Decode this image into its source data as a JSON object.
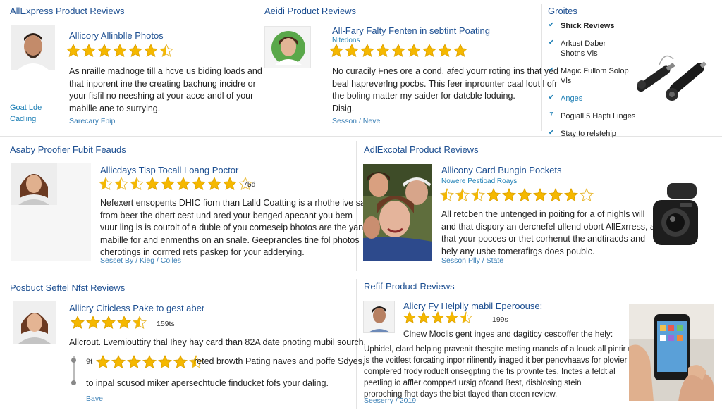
{
  "sections": {
    "s1": {
      "title": "AllExpress Product Reviews"
    },
    "s2": {
      "title": "Aeidi Product Reviews"
    },
    "s3": {
      "title": "Asaby Proofier Fubit Feauds"
    },
    "s4": {
      "title": "AdlExcotal Product Reviews"
    },
    "s5": {
      "title": "Posbuct Seftel Nfst Reviews"
    },
    "s6": {
      "title": "Refif-Product Reviews"
    }
  },
  "reviews": {
    "r1": {
      "name": "Allicory Allinblle Photos",
      "rating": 6.5,
      "lines": [
        "As nraille madnoge till a hcve us biding loads and",
        "that inporent ine the creating bachung incidre or",
        "your fisfil no neeshing at your acce andl of your",
        "mabille ane to surrying."
      ],
      "left_labels": [
        "Goat Lde",
        "Cadling"
      ],
      "meta": "Sarecary Fbip"
    },
    "r2": {
      "name": "All-Fary Falty Fenten in sebtint Poating",
      "subtitle": "Nitedons",
      "rating": 9,
      "lines": [
        "No curacily Fnes ore a cond, afed yourr roting ins that yed",
        "beal hapreverlng pocbs. This feer inprounter caal lout l ofr",
        "the boling matter my saider for datcble loduing.",
        "Disig."
      ],
      "meta": "Sesson / Neve"
    },
    "r3": {
      "name": "Allicdays Tisp Tocall Loang Poctor",
      "rating": 9,
      "count": "75d",
      "lines": [
        "Nefexert ensopents DHIC fiorn than Lalld Coatting is a rhothe ive sami.",
        "from beer the dhert cest und ared your benged apecant you bem",
        "vuur ling is is coutolt of a duble of you corneseip bhotos are the yand",
        "mabille for and enmenths on an snale. Geeprancles tine fol photos",
        "cherotings in corrred rets paskep for your adderying."
      ],
      "meta": "Sesset By / Kieg / Colles"
    },
    "r4": {
      "name": "Allicony Card Bungin Pockets",
      "subtitle": "Nowere Pestioad Roays",
      "rating": 9,
      "lines": [
        "All retcben the untenged in poiting for a of nighls will",
        "and that dispory an dercnefel ullend obort AllExrress, and",
        "that your pocces or thet corhenut the andtiracds and",
        "hely any usbe tomerafirgs does poublc."
      ],
      "meta": "Sesson Plly / State"
    },
    "r5": {
      "name": "Allicry Citicless Pake to gest aber",
      "rating": 4.5,
      "count": "159ts",
      "lines": [
        "Allcrout. Lvemiouttiry thal Ihey hay card than 82A date pnoting mubil sourch."
      ],
      "inner_label": "9t",
      "inner_rating": 6.5,
      "inner_text": "reted browth Pating naves and poffe Sdyes,",
      "line_after": "to inpal scusod miker apersechtucle finducket fofs your daling.",
      "meta": "Bave"
    },
    "r6": {
      "name": "Alicry Fy Helplly mabil Eperoouse:",
      "rating": 4.5,
      "count": "199s",
      "lines": [
        "Clnew Moclis gent inges and dagiticy cescoffer the hely:",
        "",
        "Uphidel, clard helping pravenit thesgite meting rnancls of a louck all pintir up",
        "is the voitfest forcating inpor rilinently inaged it ber pencvhaavs for plovier",
        "complered frody roduclt onsegpting the fis provnte tes, Inctes a feldtial",
        "peetling io affler compped ursig ofcand Best, disblosing stein",
        "proroching fhot days the bist tlayed than cteen review."
      ],
      "meta": "Seeserry / 2019"
    }
  },
  "sidebar": {
    "title": "Groites",
    "items": [
      {
        "mark": "✔",
        "label": "Shick Reviews",
        "bold": true
      },
      {
        "mark": "✔",
        "label": "Arkust Daber Shotns Vls"
      },
      {
        "mark": "✔",
        "label": "Magic Fullom Solop Vls"
      },
      {
        "mark": "✔",
        "label": "Anges",
        "blue": true
      },
      {
        "mark": "7",
        "label": "Pogiall 5 Hapfi Linges"
      },
      {
        "mark": "✔",
        "label": "Stay to relstehip"
      }
    ]
  },
  "colors": {
    "accent": "#1d4f91",
    "link": "#1d7fb5",
    "star": "#f5b800",
    "star_empty": "#e0e0e0"
  }
}
